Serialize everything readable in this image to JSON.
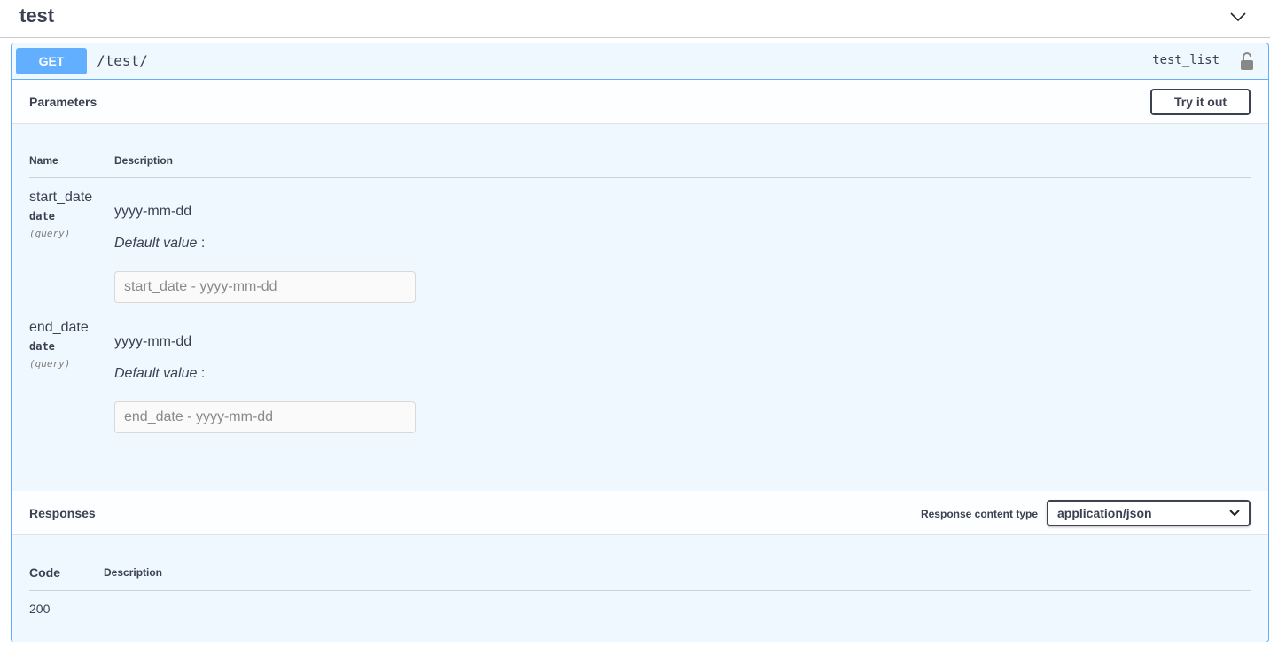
{
  "tag": {
    "title": "test"
  },
  "operation": {
    "method": "GET",
    "path": "/test/",
    "operation_id": "test_list"
  },
  "parameters_section": {
    "title": "Parameters",
    "try_button": "Try it out",
    "col_name": "Name",
    "col_description": "Description",
    "params": [
      {
        "name": "start_date",
        "type": "date",
        "in": "(query)",
        "description": "yyyy-mm-dd",
        "default_label": "Default value",
        "default_sep": " :",
        "placeholder": "start_date - yyyy-mm-dd"
      },
      {
        "name": "end_date",
        "type": "date",
        "in": "(query)",
        "description": "yyyy-mm-dd",
        "default_label": "Default value",
        "default_sep": " :",
        "placeholder": "end_date - yyyy-mm-dd"
      }
    ]
  },
  "responses_section": {
    "title": "Responses",
    "content_type_label": "Response content type",
    "content_type_value": "application/json",
    "col_code": "Code",
    "col_description": "Description",
    "rows": [
      {
        "code": "200"
      }
    ]
  },
  "colors": {
    "get_accent": "#61affe",
    "text": "#3b4151"
  },
  "icons": {
    "collapse": "chevron-down-icon",
    "auth": "unlock-icon",
    "select": "chevron-down-icon"
  }
}
